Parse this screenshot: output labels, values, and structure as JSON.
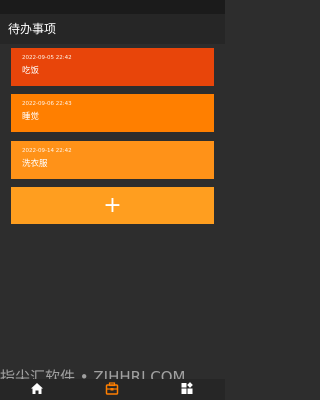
{
  "app_bar": {
    "title": "待办事项"
  },
  "todos": [
    {
      "date": "2022-09-05 22:42",
      "title": "吃饭",
      "color": "#e8450a"
    },
    {
      "date": "2022-09-06 22:43",
      "title": "睡觉",
      "color": "#ff7f00"
    },
    {
      "date": "2022-09-14 22:42",
      "title": "洗衣服",
      "color": "#ff9218"
    }
  ],
  "add_button": {
    "icon": "plus-icon",
    "label": "+"
  },
  "watermark": {
    "text": "指尖汇软件 • ZJHHRJ.COM"
  },
  "tabs": [
    {
      "name": "home",
      "icon": "home-icon",
      "active": false
    },
    {
      "name": "todo",
      "icon": "todo-box-icon",
      "active": true
    },
    {
      "name": "widgets",
      "icon": "widgets-icon",
      "active": false
    }
  ],
  "colors": {
    "background": "#2d2d2d",
    "app_bar": "#262626",
    "tab_active": "#ff7f00",
    "tab_inactive": "#ffffff"
  }
}
